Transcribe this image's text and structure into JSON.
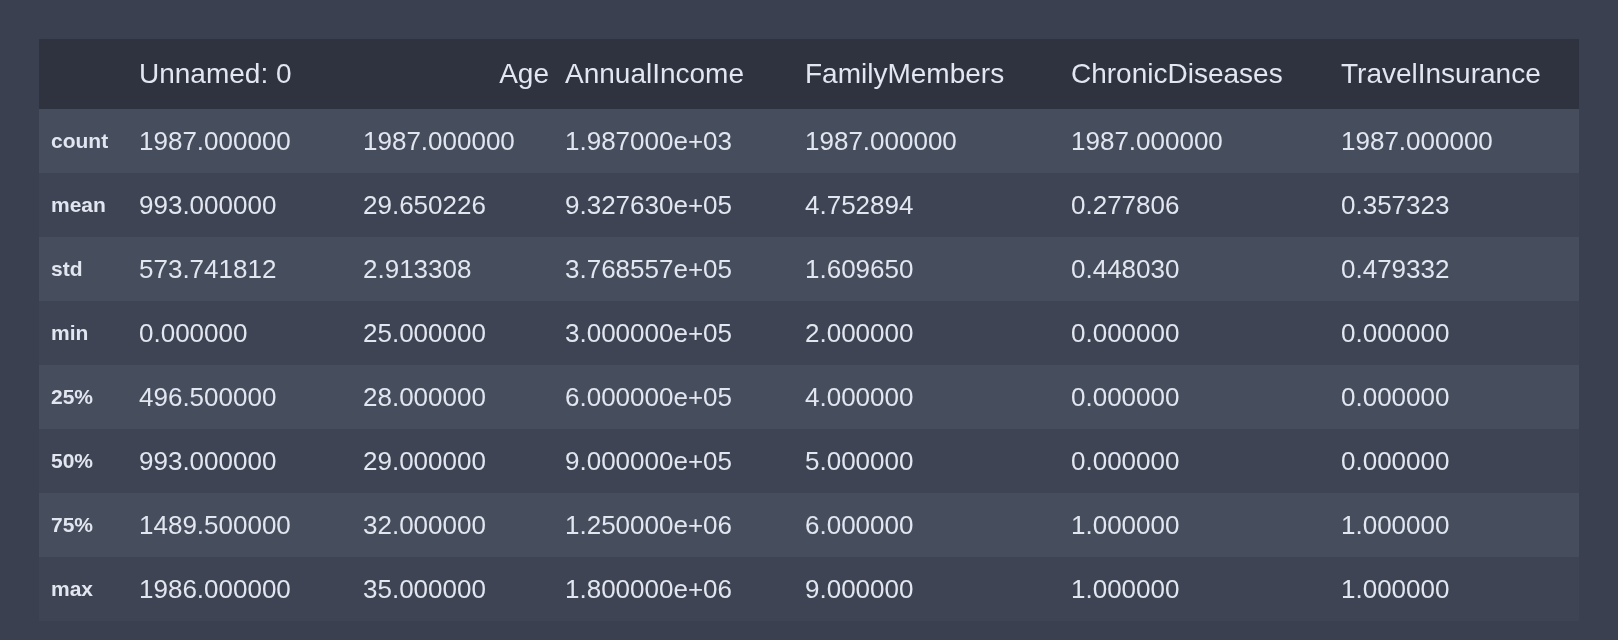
{
  "table": {
    "columns": [
      "Unnamed: 0",
      "Age",
      "AnnualIncome",
      "FamilyMembers",
      "ChronicDiseases",
      "TravelInsurance"
    ],
    "rows": [
      {
        "label": "count",
        "cells": [
          "1987.000000",
          "1987.000000",
          "1.987000e+03",
          "1987.000000",
          "1987.000000",
          "1987.000000"
        ]
      },
      {
        "label": "mean",
        "cells": [
          "993.000000",
          "29.650226",
          "9.327630e+05",
          "4.752894",
          "0.277806",
          "0.357323"
        ]
      },
      {
        "label": "std",
        "cells": [
          "573.741812",
          "2.913308",
          "3.768557e+05",
          "1.609650",
          "0.448030",
          "0.479332"
        ]
      },
      {
        "label": "min",
        "cells": [
          "0.000000",
          "25.000000",
          "3.000000e+05",
          "2.000000",
          "0.000000",
          "0.000000"
        ]
      },
      {
        "label": "25%",
        "cells": [
          "496.500000",
          "28.000000",
          "6.000000e+05",
          "4.000000",
          "0.000000",
          "0.000000"
        ]
      },
      {
        "label": "50%",
        "cells": [
          "993.000000",
          "29.000000",
          "9.000000e+05",
          "5.000000",
          "0.000000",
          "0.000000"
        ]
      },
      {
        "label": "75%",
        "cells": [
          "1489.500000",
          "32.000000",
          "1.250000e+06",
          "6.000000",
          "1.000000",
          "1.000000"
        ]
      },
      {
        "label": "max",
        "cells": [
          "1986.000000",
          "35.000000",
          "1.800000e+06",
          "9.000000",
          "1.000000",
          "1.000000"
        ]
      }
    ]
  }
}
